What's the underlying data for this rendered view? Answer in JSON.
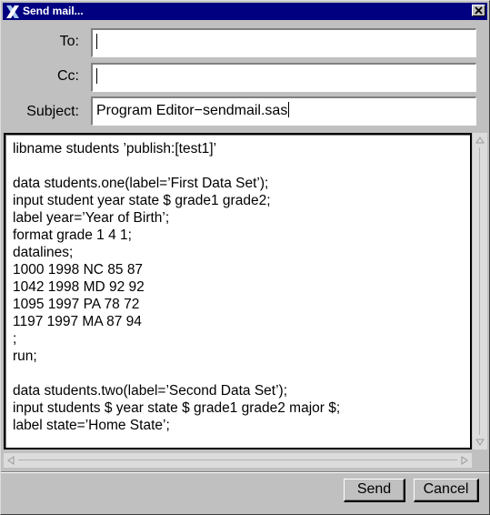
{
  "window": {
    "title": "Send mail..."
  },
  "fields": {
    "to": {
      "label": "To:",
      "value": ""
    },
    "cc": {
      "label": "Cc:",
      "value": ""
    },
    "subject": {
      "label": "Subject:",
      "value": "Program Editor−sendmail.sas"
    }
  },
  "editor": {
    "lines": [
      "libname students ’publish:[test1]’",
      "",
      "data students.one(label=’First Data Set’);",
      "input student year state $ grade1 grade2;",
      "label year=’Year of Birth’;",
      "format grade 1 4 1;",
      "datalines;",
      "1000 1998 NC 85 87",
      "1042 1998 MD 92 92",
      "1095 1997 PA 78 72",
      "1197 1997 MA 87 94",
      ";",
      "run;",
      "",
      "data students.two(label=’Second Data Set’);",
      "input students $ year state $ grade1 grade2 major $;",
      "label state=’Home State’;"
    ]
  },
  "buttons": {
    "send": "Send",
    "cancel": "Cancel"
  },
  "icons": {
    "app": "x-window-icon",
    "close": "close-icon"
  }
}
